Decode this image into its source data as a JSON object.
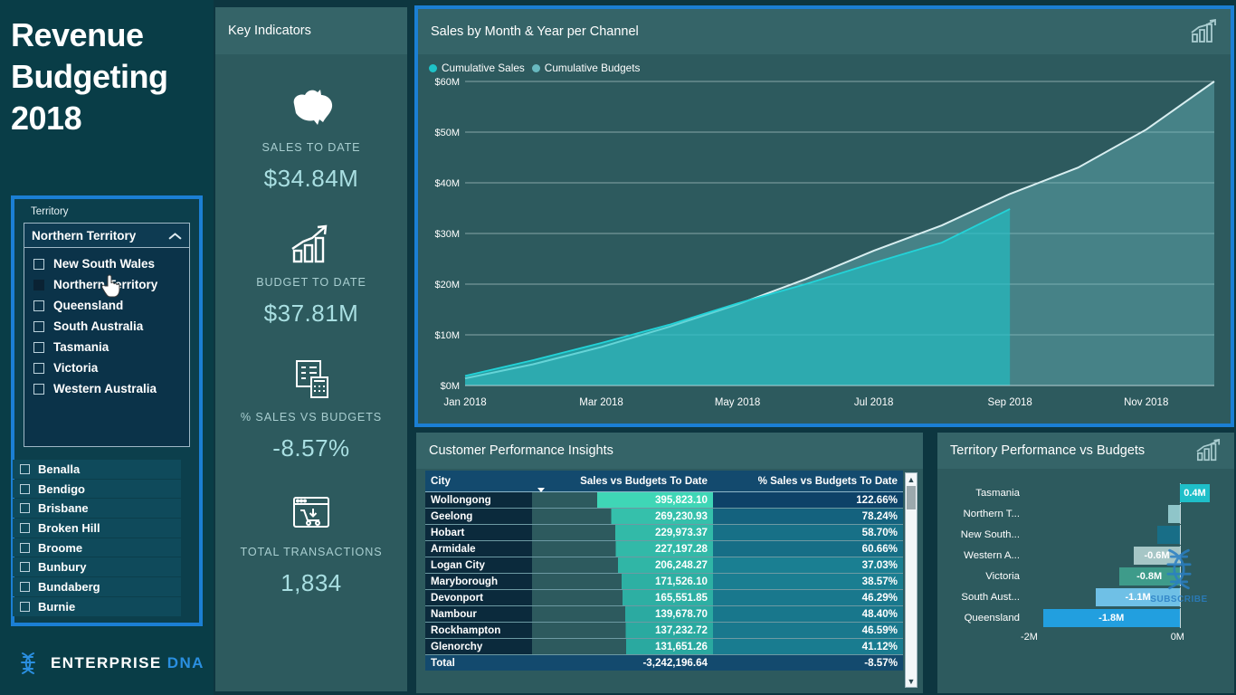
{
  "page": {
    "title_lines": [
      "Revenue",
      "Budgeting",
      "2018"
    ],
    "accent_blue": "#1b7fd4",
    "panel_bg": "#2d5a5e",
    "sidebar_bg": "#093d47"
  },
  "logo": {
    "word_primary": "ENTERPRISE",
    "word_secondary": "DNA",
    "icon": "dna-helix-icon"
  },
  "territory_slicer": {
    "label": "Territory",
    "selected": "Northern Territory",
    "expanded": true,
    "chevron": "chevron-up-icon",
    "options": [
      {
        "label": "New South Wales",
        "checked": false
      },
      {
        "label": "Northern Territory",
        "checked": true
      },
      {
        "label": "Queensland",
        "checked": false
      },
      {
        "label": "South Australia",
        "checked": false
      },
      {
        "label": "Tasmania",
        "checked": false
      },
      {
        "label": "Victoria",
        "checked": false
      },
      {
        "label": "Western Australia",
        "checked": false
      }
    ]
  },
  "city_slicer": {
    "options": [
      {
        "label": "Benalla",
        "checked": false
      },
      {
        "label": "Bendigo",
        "checked": false
      },
      {
        "label": "Brisbane",
        "checked": false
      },
      {
        "label": "Broken Hill",
        "checked": false
      },
      {
        "label": "Broome",
        "checked": false
      },
      {
        "label": "Bunbury",
        "checked": false
      },
      {
        "label": "Bundaberg",
        "checked": false
      },
      {
        "label": "Burnie",
        "checked": false
      }
    ]
  },
  "key_indicators": {
    "header": "Key Indicators",
    "items": [
      {
        "icon": "australia-map-icon",
        "label": "SALES TO DATE",
        "value": "$34.84M"
      },
      {
        "icon": "growth-chart-icon",
        "label": "BUDGET TO DATE",
        "value": "$37.81M"
      },
      {
        "icon": "invoice-calculator-icon",
        "label": "% SALES VS BUDGETS",
        "value": "-8.57%"
      },
      {
        "icon": "shopping-cart-icon",
        "label": "TOTAL TRANSACTIONS",
        "value": "1,834"
      }
    ]
  },
  "area_chart_panel": {
    "header": "Sales by Month & Year per Channel",
    "corner_icon": "bar-chart-growth-icon"
  },
  "table_panel": {
    "header": "Customer Performance Insights",
    "columns": [
      "City",
      "Sales vs Budgets To Date",
      "% Sales vs Budgets To Date"
    ],
    "sorted_column_index": 1,
    "rows": [
      {
        "city": "Wollongong",
        "sales_vs_budgets": "395,823.10",
        "pct": "122.66%"
      },
      {
        "city": "Geelong",
        "sales_vs_budgets": "269,230.93",
        "pct": "78.24%"
      },
      {
        "city": "Hobart",
        "sales_vs_budgets": "229,973.37",
        "pct": "58.70%"
      },
      {
        "city": "Armidale",
        "sales_vs_budgets": "227,197.28",
        "pct": "60.66%"
      },
      {
        "city": "Logan City",
        "sales_vs_budgets": "206,248.27",
        "pct": "37.03%"
      },
      {
        "city": "Maryborough",
        "sales_vs_budgets": "171,526.10",
        "pct": "38.57%"
      },
      {
        "city": "Devonport",
        "sales_vs_budgets": "165,551.85",
        "pct": "46.29%"
      },
      {
        "city": "Nambour",
        "sales_vs_budgets": "139,678.70",
        "pct": "48.40%"
      },
      {
        "city": "Rockhampton",
        "sales_vs_budgets": "137,232.72",
        "pct": "46.59%"
      },
      {
        "city": "Glenorchy",
        "sales_vs_budgets": "131,651.26",
        "pct": "41.12%"
      }
    ],
    "total": {
      "city": "Total",
      "sales_vs_budgets": "-3,242,196.64",
      "pct": "-8.57%"
    }
  },
  "bar_panel": {
    "header": "Territory Performance vs Budgets",
    "corner_icon": "bar-chart-growth-icon",
    "watermark": "SUBSCRIBE"
  },
  "chart_data": [
    {
      "type": "area",
      "title": "Sales by Month & Year per Channel",
      "xlabel": "",
      "ylabel": "",
      "ylim": [
        0,
        60
      ],
      "y_ticks": [
        "$0M",
        "$10M",
        "$20M",
        "$30M",
        "$40M",
        "$50M",
        "$60M"
      ],
      "x_ticks": [
        "Jan 2018",
        "Mar 2018",
        "May 2018",
        "Jul 2018",
        "Sep 2018",
        "Nov 2018"
      ],
      "grid": true,
      "legend_position": "top-left",
      "x": [
        "Jan 2018",
        "Feb 2018",
        "Mar 2018",
        "Apr 2018",
        "May 2018",
        "Jun 2018",
        "Jul 2018",
        "Aug 2018",
        "Sep 2018",
        "Oct 2018",
        "Nov 2018",
        "Dec 2018"
      ],
      "series": [
        {
          "name": "Cumulative Sales",
          "color": "#1ec3c8",
          "values": [
            1.9,
            5.0,
            8.4,
            12.0,
            16.2,
            20.0,
            24.2,
            28.2,
            34.84,
            null,
            null,
            null
          ]
        },
        {
          "name": "Cumulative Budgets",
          "color": "#68b9c0",
          "values": [
            1.4,
            4.2,
            7.6,
            11.6,
            16.0,
            21.0,
            26.6,
            31.6,
            37.81,
            43.0,
            50.5,
            60.0
          ]
        }
      ]
    },
    {
      "type": "bar",
      "orientation": "horizontal",
      "title": "Territory Performance vs Budgets",
      "xlabel": "",
      "ylabel": "",
      "xlim": [
        -2,
        0.6
      ],
      "x_ticks": [
        "-2M",
        "0M"
      ],
      "grid": false,
      "categories": [
        "Tasmania",
        "Northern T...",
        "New South...",
        "Western A...",
        "Victoria",
        "South Aust...",
        "Queensland"
      ],
      "values": [
        0.4,
        -0.15,
        -0.3,
        -0.6,
        -0.8,
        -1.1,
        -1.8
      ],
      "labels": [
        "0.4M",
        "",
        "",
        "-0.6M",
        "-0.8M",
        "-1.1M",
        "-1.8M"
      ],
      "colors": [
        "#1fbfc9",
        "#8fc5c9",
        "#186e87",
        "#a6c6c6",
        "#3e9b8a",
        "#6fc0e6",
        "#229fdf"
      ]
    }
  ]
}
